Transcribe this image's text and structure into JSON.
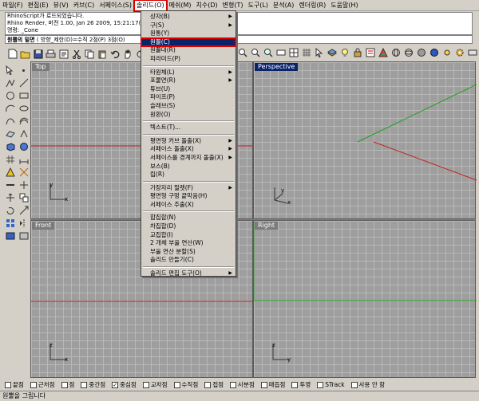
{
  "menubar": [
    "파일(F)",
    "편집(E)",
    "뷰(V)",
    "커브(C)",
    "서페이스(S)",
    "솔리드(O)",
    "메쉬(M)",
    "치수(D)",
    "변형(T)",
    "도구(L)",
    "분석(A)",
    "렌더링(R)",
    "도움말(H)"
  ],
  "command_history": [
    "RhinoScript가 로드되었습니다.",
    "Rhino Render, 버전 1.00, Jan 26 2009, 15:21:17(을)",
    "명령: _Cone"
  ],
  "command_prompt": {
    "label": "원뿔의 밑면",
    "options": "( 방향_제한(D)=수직  2점(P)  3점(O)"
  },
  "viewports": {
    "top": "Top",
    "perspective": "Perspective",
    "front": "Front",
    "right": "Right"
  },
  "axis_labels": {
    "x": "x",
    "y": "y",
    "z": "z"
  },
  "solid_menu": {
    "groups": [
      [
        {
          "label": "상자(B)",
          "sub": true
        },
        {
          "label": "구(S)",
          "sub": true
        },
        {
          "label": "원통(Y)",
          "sub": false
        },
        {
          "label": "원뿔(C)",
          "sub": false,
          "highlighted": true
        },
        {
          "label": "원뿔대(R)",
          "sub": false
        },
        {
          "label": "피라미드(P)",
          "sub": false
        }
      ],
      [
        {
          "label": "타원체(L)",
          "sub": true
        },
        {
          "label": "포물면(R)",
          "sub": true
        },
        {
          "label": "튜브(U)",
          "sub": false
        },
        {
          "label": "파이프(P)",
          "sub": false
        },
        {
          "label": "슬래브(S)",
          "sub": false
        },
        {
          "label": "원환(O)",
          "sub": false
        }
      ],
      [
        {
          "label": "텍스트(T)...",
          "sub": false
        }
      ],
      [
        {
          "label": "평면형 커브 돌출(X)",
          "sub": true
        },
        {
          "label": "서페이스 돌출(X)",
          "sub": true
        },
        {
          "label": "서페이스를 경계까지 돌출(X)",
          "sub": true
        },
        {
          "label": "보스(B)",
          "sub": false
        },
        {
          "label": "립(R)",
          "sub": false
        }
      ],
      [
        {
          "label": "가장자리 필렛(F)",
          "sub": true
        },
        {
          "label": "평면형 구멍 끝막음(H)",
          "sub": false
        },
        {
          "label": "서페이스 추출(X)",
          "sub": false
        }
      ],
      [
        {
          "label": "합집합(N)",
          "sub": false
        },
        {
          "label": "차집합(D)",
          "sub": false
        },
        {
          "label": "교집합(I)",
          "sub": false
        },
        {
          "label": "2 개체 부울 연산(W)",
          "sub": false
        },
        {
          "label": "부울 연산 분할(S)",
          "sub": false
        },
        {
          "label": "솔리드 만들기(C)",
          "sub": false
        }
      ],
      [
        {
          "label": "솔리드 편집 도구(O)",
          "sub": true
        }
      ]
    ]
  },
  "osnaps": [
    {
      "label": "끝점",
      "checked": false
    },
    {
      "label": "근처점",
      "checked": false
    },
    {
      "label": "점",
      "checked": false
    },
    {
      "label": "중간점",
      "checked": false
    },
    {
      "label": "중심점",
      "checked": true
    },
    {
      "label": "교차점",
      "checked": false
    },
    {
      "label": "수직점",
      "checked": false
    },
    {
      "label": "접점",
      "checked": false
    },
    {
      "label": "사분점",
      "checked": false
    },
    {
      "label": "매듭점",
      "checked": false
    },
    {
      "label": "투영",
      "checked": false
    },
    {
      "label": "STrack",
      "checked": false
    },
    {
      "label": "사용 안 함",
      "checked": false
    }
  ],
  "status_text": "원뿔을 그립니다",
  "colors": {
    "active_label": "#0a246a",
    "highlight_outline": "#e00000",
    "x_axis": "#c02020",
    "y_axis": "#20a020"
  }
}
